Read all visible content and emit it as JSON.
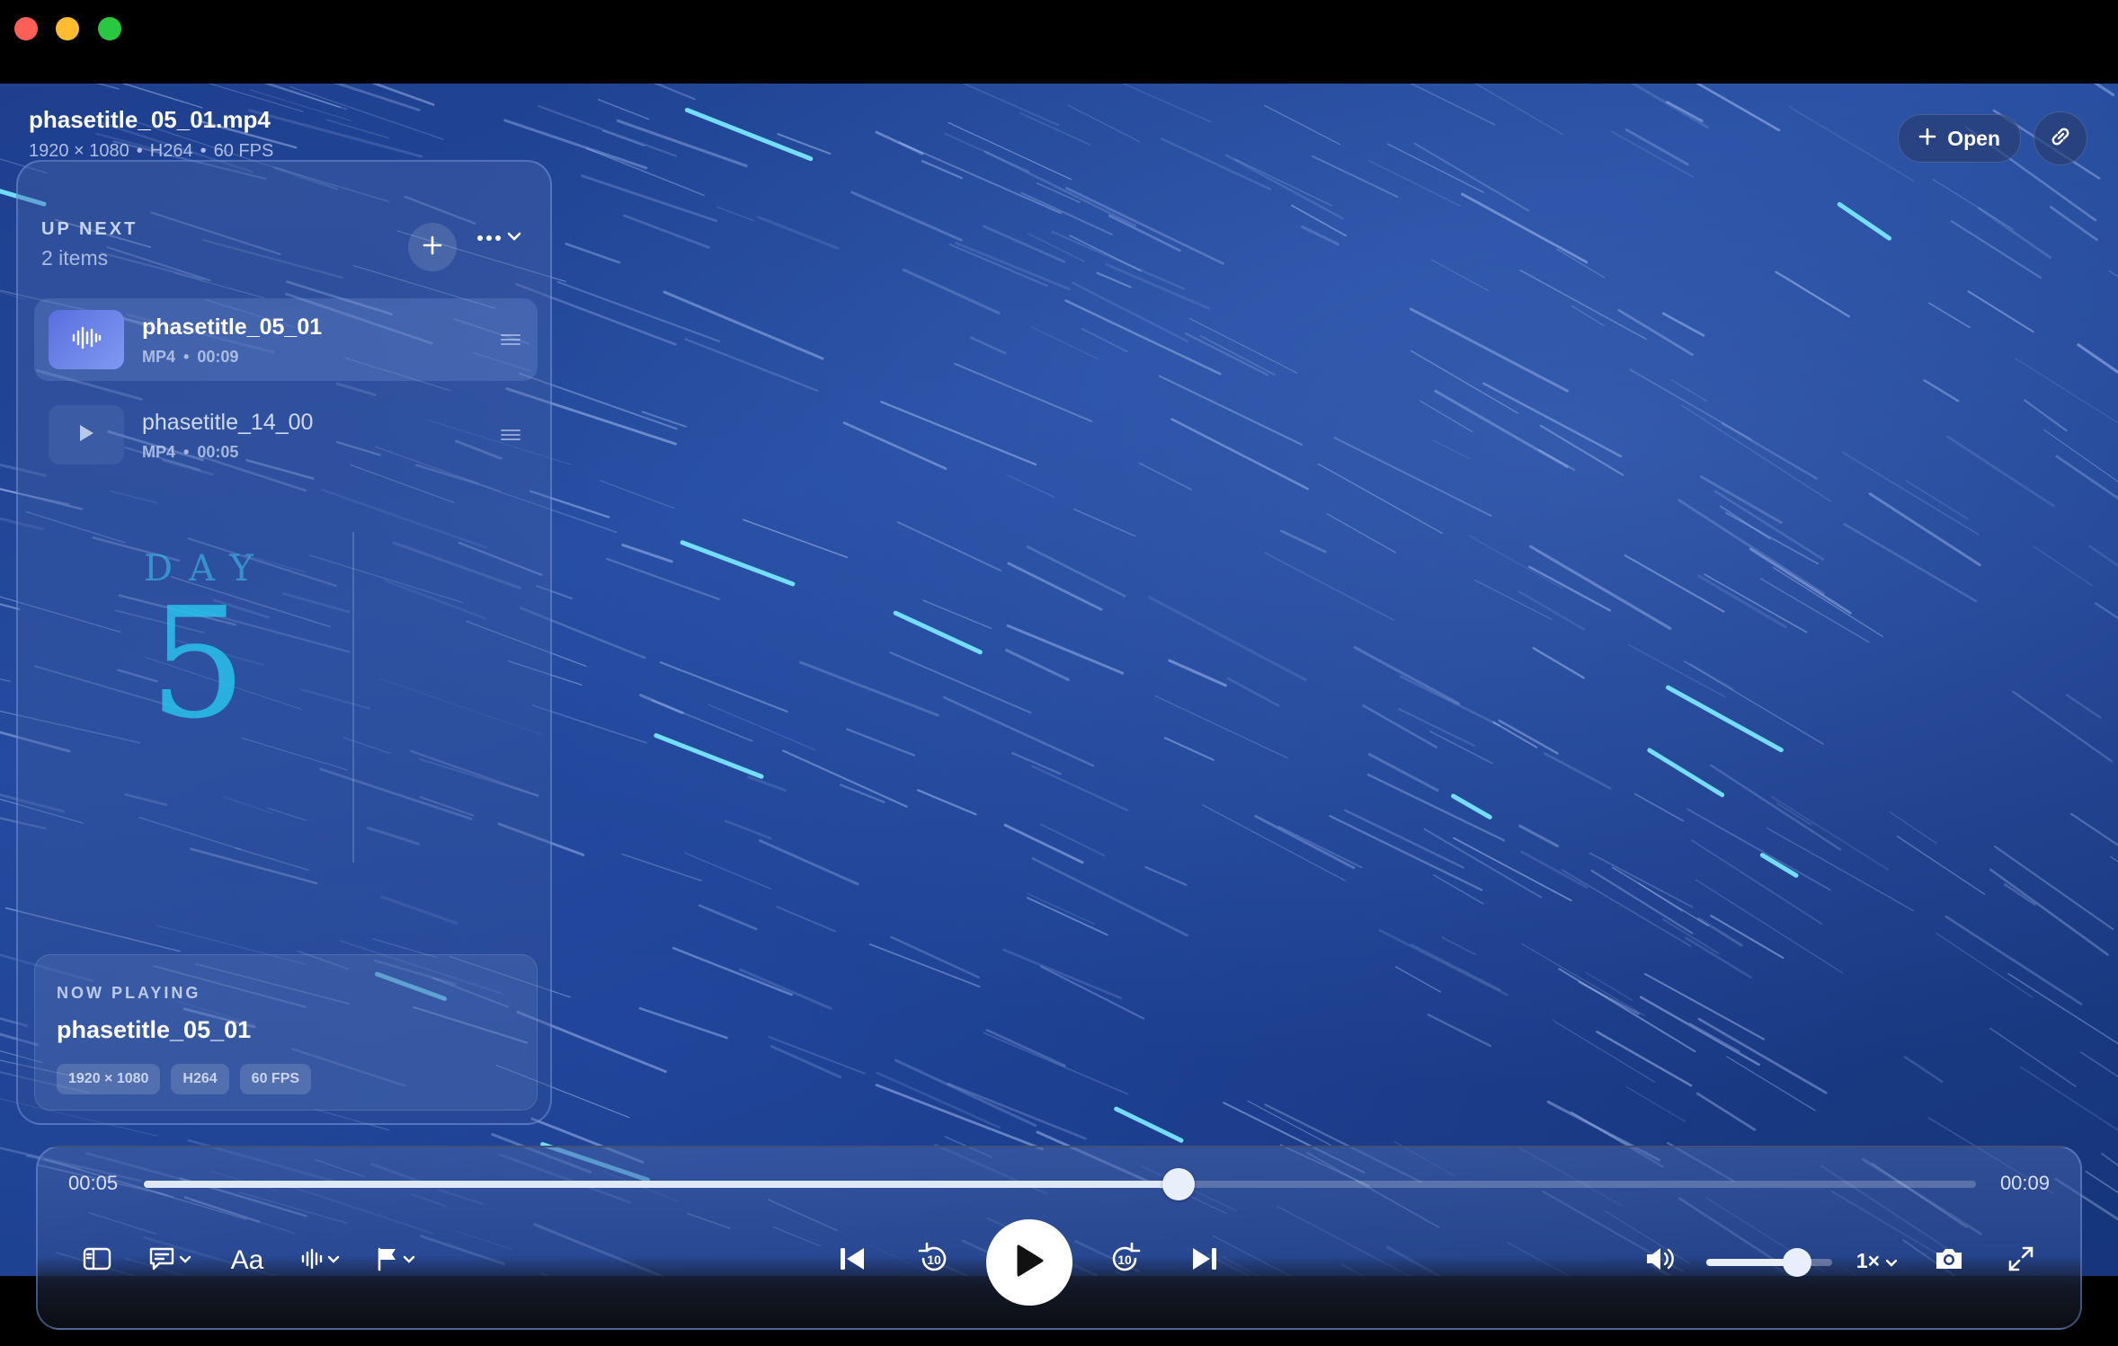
{
  "window": {
    "traffic_lights": [
      "close",
      "minimize",
      "zoom"
    ]
  },
  "file": {
    "title": "phasetitle_05_01.mp4",
    "resolution": "1920 × 1080",
    "codec": "H264",
    "fps": "60 FPS",
    "separator": "•"
  },
  "top_right": {
    "open_label": "Open",
    "open_icon": "plus-icon",
    "link_icon": "link-icon"
  },
  "sidebar": {
    "title": "UP NEXT",
    "count": "2 items",
    "items": [
      {
        "title": "phasetitle_05_01",
        "format": "MP4",
        "duration": "00:09",
        "active": true,
        "icon": "waveform-icon"
      },
      {
        "title": "phasetitle_14_00",
        "format": "MP4",
        "duration": "00:05",
        "active": false,
        "icon": "play-icon"
      }
    ],
    "separator": "•",
    "art": {
      "word": "DAY",
      "number": "5"
    },
    "now_playing": {
      "label": "NOW PLAYING",
      "title": "phasetitle_05_01",
      "chips": [
        "1920 × 1080",
        "H264",
        "60 FPS"
      ]
    }
  },
  "controls": {
    "current_time": "00:05",
    "duration": "00:09",
    "progress": 0.565,
    "volume": 0.72,
    "rate": "1×",
    "skip_seconds": "10",
    "typography_label": "Aa",
    "accent": "#ffffff"
  }
}
